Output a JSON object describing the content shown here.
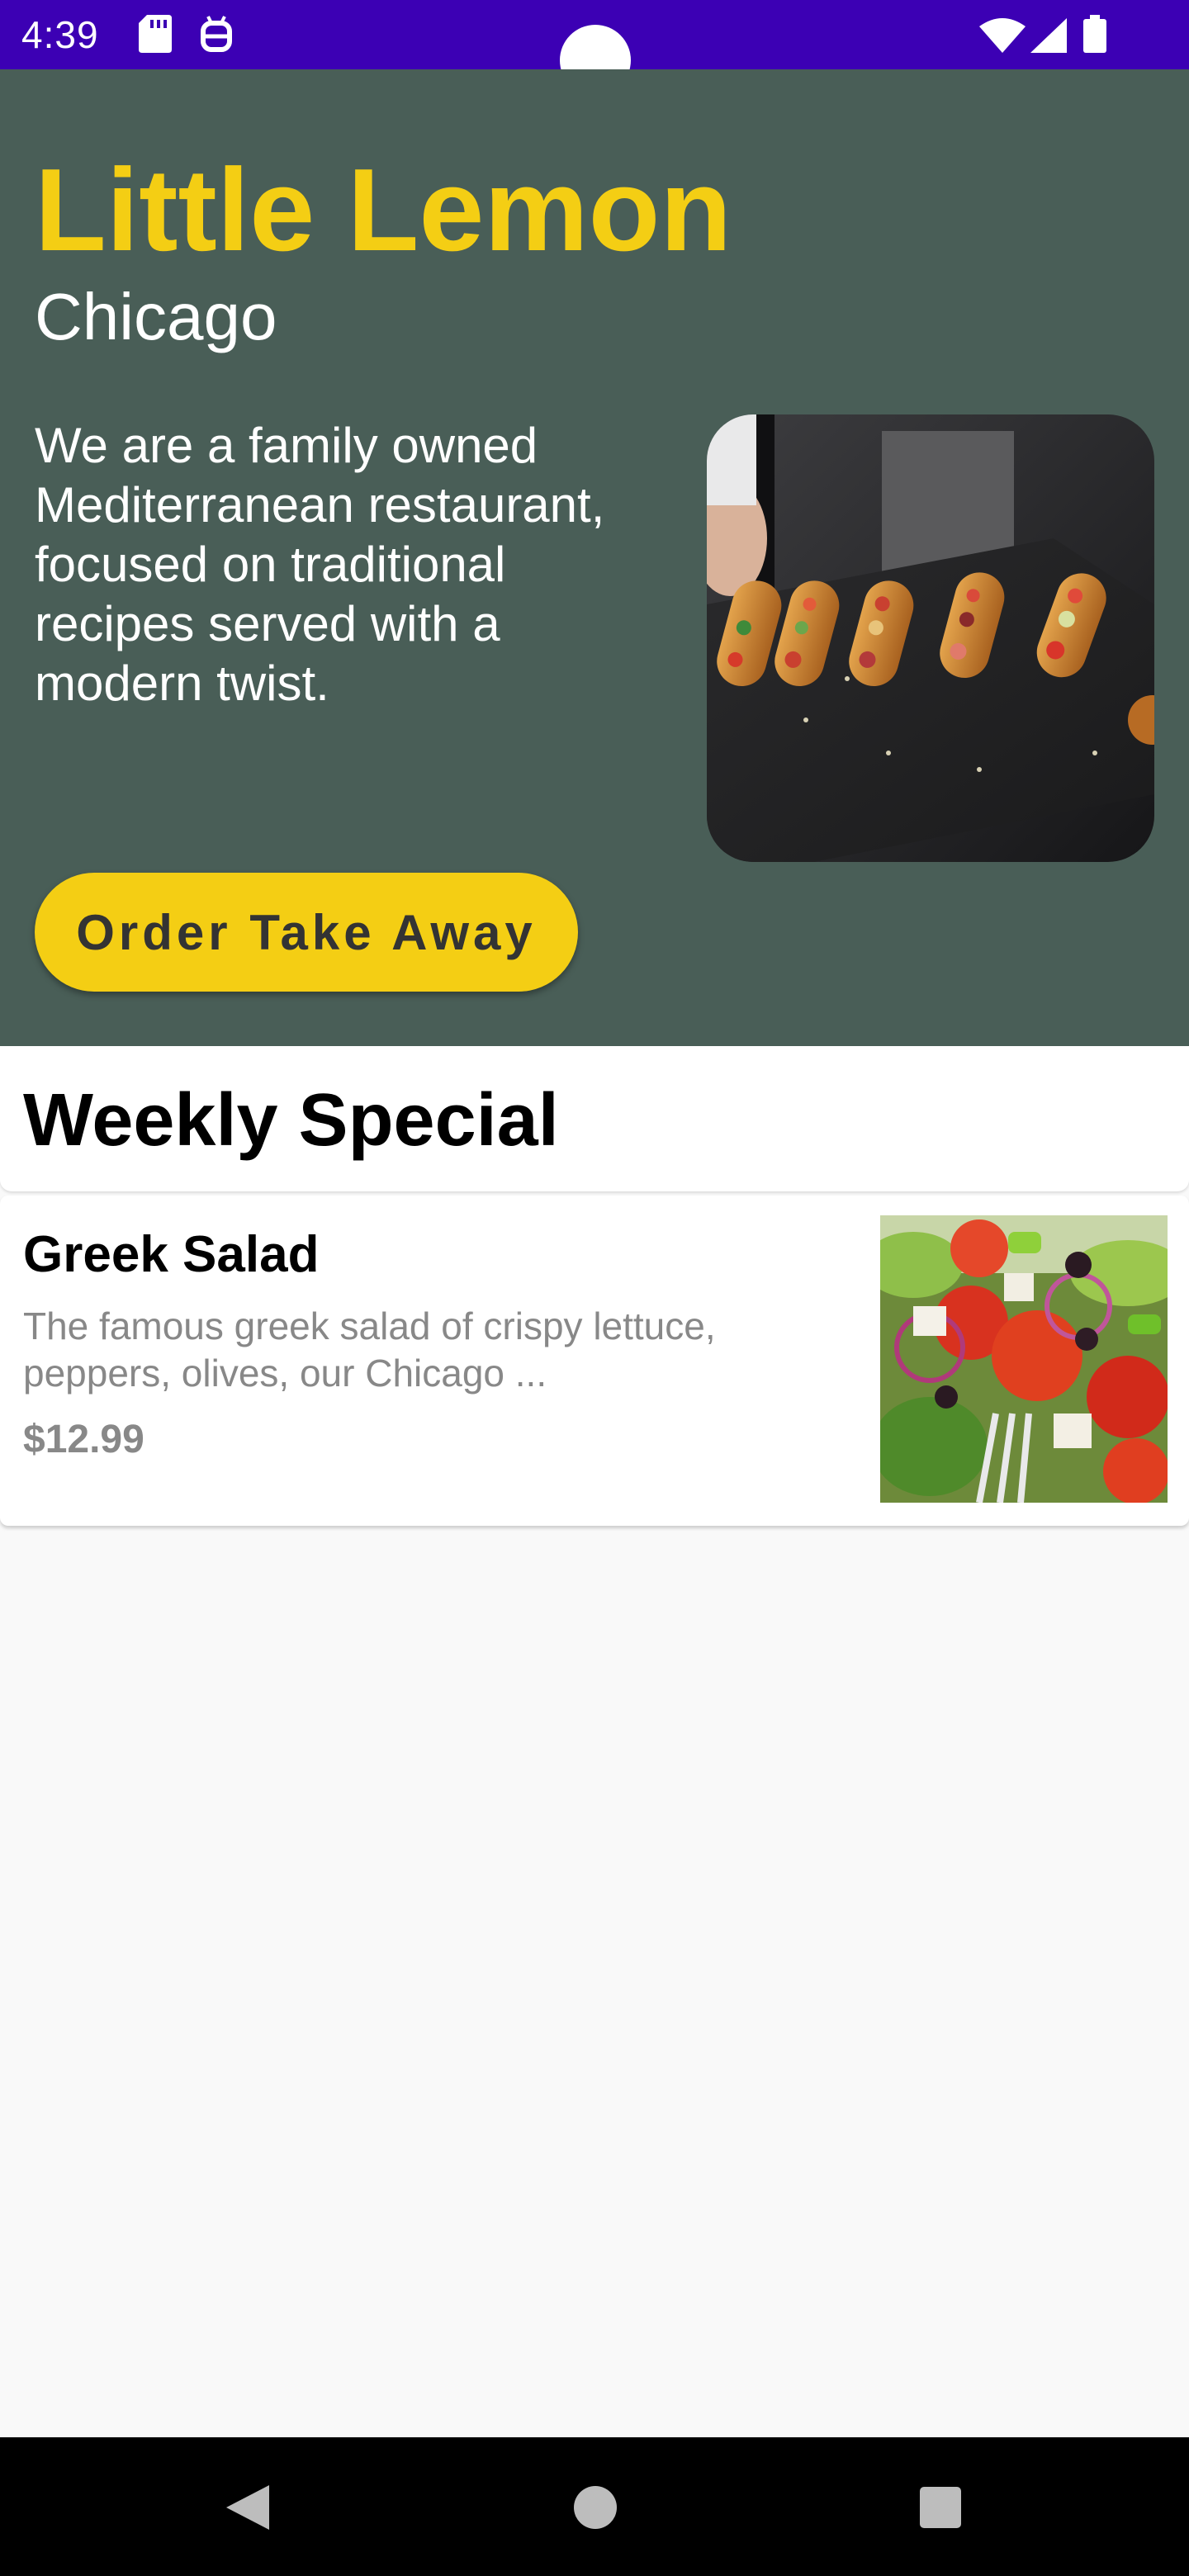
{
  "status_bar": {
    "time": "4:39",
    "icons": [
      "sd-card-icon",
      "android-debug-icon",
      "wifi-icon",
      "signal-icon",
      "battery-icon"
    ]
  },
  "hero": {
    "title": "Little Lemon",
    "city": "Chicago",
    "description": "We are a family owned Mediterranean restaurant, focused on traditional recipes served with a modern twist.",
    "order_button_label": "Order Take Away"
  },
  "weekly_special": {
    "title": "Weekly Special",
    "items": [
      {
        "name": "Greek Salad",
        "description": "The famous greek salad of crispy lettuce, peppers, olives, our Chicago ...",
        "price": "$12.99"
      }
    ]
  },
  "nav_bar": {
    "buttons": [
      "back-icon",
      "home-icon",
      "recents-icon"
    ]
  },
  "colors": {
    "status_bar": "#3c00b4",
    "hero_background": "#495e57",
    "accent_yellow": "#f4ce14",
    "page_background": "#f9f9f9"
  }
}
